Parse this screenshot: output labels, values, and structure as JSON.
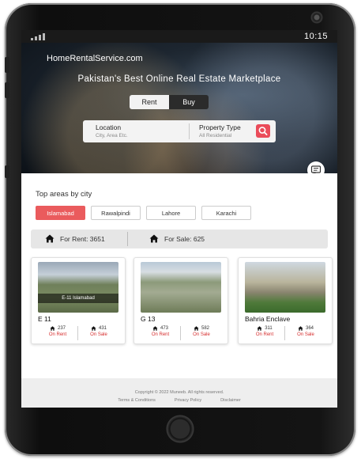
{
  "status_bar": {
    "time": "10:15"
  },
  "header": {
    "brand": "HomeRentalService.com",
    "tagline": "Pakistan's Best Online Real Estate Marketplace",
    "toggle": {
      "rent": "Rent",
      "buy": "Buy",
      "selected": "Rent"
    }
  },
  "search": {
    "location_label": "Location",
    "location_placeholder": "City, Area Etc.",
    "type_label": "Property Type",
    "type_value": "All Residential"
  },
  "areas": {
    "title": "Top areas by city",
    "cities": [
      "Islamabad",
      "Rawalpindi",
      "Lahore",
      "Karachi"
    ],
    "selected": "Islamabad"
  },
  "stats": {
    "rent": "For Rent: 3651",
    "sale": "For Sale: 625"
  },
  "cards": [
    {
      "name": "E 11",
      "overlay": "E-11 Islamabad",
      "rent_count": "237",
      "sale_count": "431",
      "rent_label": "On Rent",
      "sale_label": "On Sale"
    },
    {
      "name": "G 13",
      "overlay": "",
      "rent_count": "473",
      "sale_count": "582",
      "rent_label": "On Rent",
      "sale_label": "On Sale"
    },
    {
      "name": "Bahria Enclave",
      "overlay": "",
      "rent_count": "311",
      "sale_count": "364",
      "rent_label": "On Rent",
      "sale_label": "On Sale"
    }
  ],
  "footer": {
    "copyright": "Copyright © 2022 Muneeb. All rights reserved.",
    "links": [
      "Terms & Conditions",
      "Privacy Policy",
      "Disclaimer"
    ]
  },
  "icons": {
    "home": "home-icon",
    "search": "search-icon",
    "chat": "chat-icon"
  },
  "colors": {
    "accent": "#ea5b5d",
    "dark": "#2b2b2b"
  }
}
